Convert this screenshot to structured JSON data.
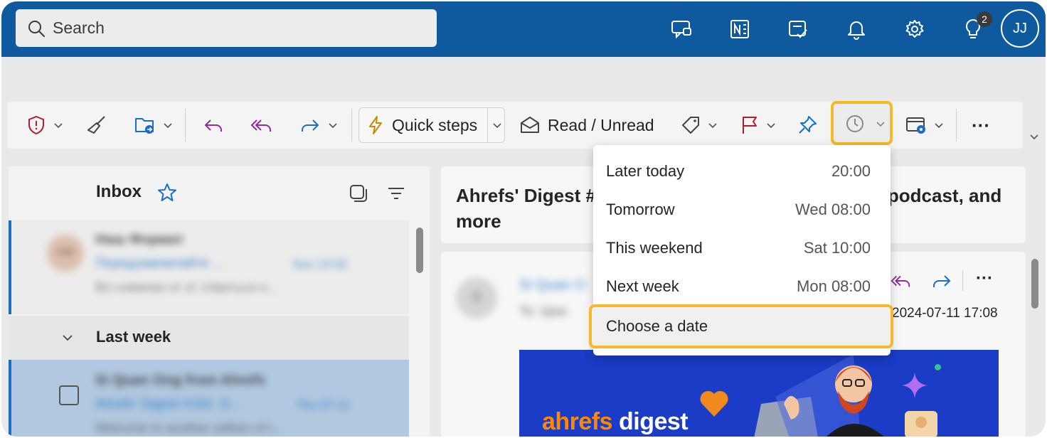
{
  "topbar": {
    "search_label": "Search",
    "notification_count": "2",
    "avatar_initials": "JJ",
    "icons": [
      "chat-icon",
      "onenote-icon",
      "todo-icon",
      "bell-icon",
      "gear-icon",
      "lightbulb-icon"
    ]
  },
  "ribbon": {
    "quick_steps_label": "Quick steps",
    "read_unread_label": "Read / Unread",
    "more_label": "···"
  },
  "inbox": {
    "title": "Inbox",
    "group_label": "Last week",
    "item1": {
      "sender": "Наш Формат",
      "subject": "Передзамовлайте ...",
      "time": "Sun 13:32",
      "preview": "Всі новинки от от з'явиться н...",
      "avatar": "НФ"
    },
    "item2": {
      "sender": "Si Quan Ong from Ahrefs",
      "subject": "Ahrefs' Digest #191: S...",
      "time": "Thu 07-11",
      "preview": "Welcome to another edition of t..."
    }
  },
  "reading": {
    "subject_left": "Ahrefs' Digest #",
    "subject_right": "podcast, and",
    "subject_line2": "more",
    "sender_initial": "S",
    "sender_name": "Si Quan O",
    "to_label": "To: Ших",
    "date": "2024-07-11 17:08",
    "banner_word1": "ahrefs",
    "banner_word2": " digest"
  },
  "snooze_menu": {
    "items": [
      {
        "label": "Later today",
        "time": "20:00"
      },
      {
        "label": "Tomorrow",
        "time": "Wed 08:00"
      },
      {
        "label": "This weekend",
        "time": "Sat 10:00"
      },
      {
        "label": "Next week",
        "time": "Mon 08:00"
      }
    ],
    "choose_date_label": "Choose a date"
  },
  "colors": {
    "topbar": "#0f5a9f",
    "highlight": "#f6b92b",
    "selected_row": "#b1c8e0",
    "accent": "#1b6ec2"
  }
}
